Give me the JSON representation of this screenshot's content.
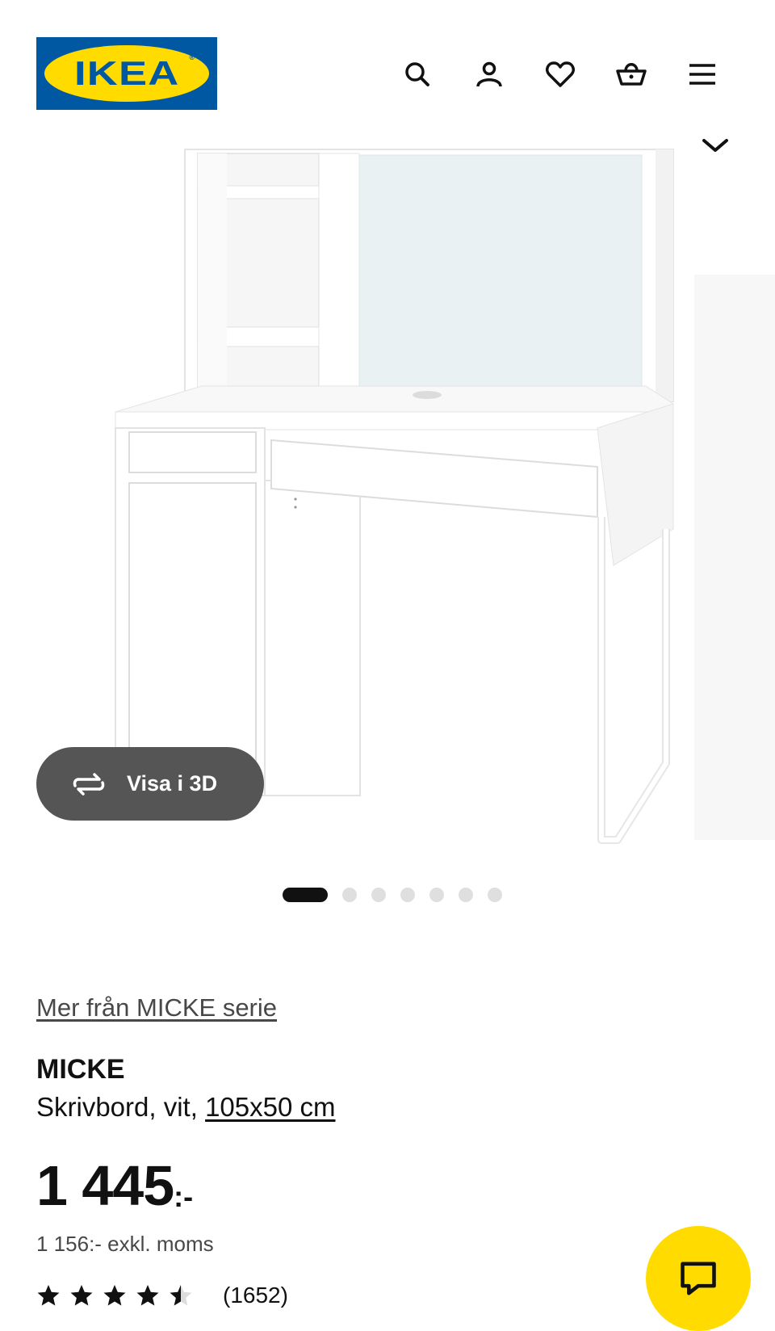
{
  "header": {
    "logo_text": "IKEA",
    "logo_reg": "®",
    "icons": [
      "search-icon",
      "account-icon",
      "heart-icon",
      "basket-icon",
      "menu-icon"
    ]
  },
  "gallery": {
    "view3d_label": "Visa i 3D",
    "image_count": 7,
    "active_image": 1
  },
  "product": {
    "series_link": "Mer från MICKE serie",
    "name": "MICKE",
    "description": "Skrivbord, vit,",
    "size": "105x50 cm",
    "price": "1 445",
    "price_suffix": ":-",
    "price_excl": "1 156:- exkl. moms",
    "rating": 4.5,
    "rating_max": 5,
    "review_count": "(1652)"
  },
  "colors": {
    "ikea_blue": "#0058a3",
    "ikea_yellow": "#ffdb00",
    "pill_gray": "#555555"
  }
}
